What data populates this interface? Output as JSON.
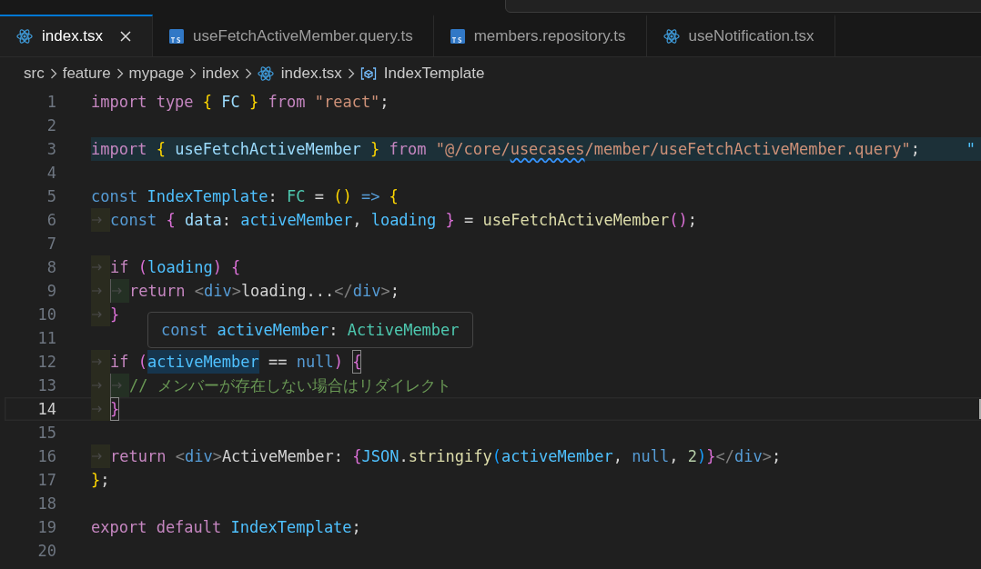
{
  "tabs": [
    {
      "label": "index.tsx",
      "kind": "react",
      "selected": true
    },
    {
      "label": "useFetchActiveMember.query.ts",
      "kind": "ts",
      "selected": false
    },
    {
      "label": "members.repository.ts",
      "kind": "ts",
      "selected": false
    },
    {
      "label": "useNotification.tsx",
      "kind": "react",
      "selected": false
    }
  ],
  "breadcrumb": [
    {
      "label": "src",
      "kind": "folder"
    },
    {
      "label": "feature",
      "kind": "folder"
    },
    {
      "label": "mypage",
      "kind": "folder"
    },
    {
      "label": "index",
      "kind": "folder"
    },
    {
      "label": "index.tsx",
      "kind": "react"
    },
    {
      "label": "IndexTemplate",
      "kind": "symbol"
    }
  ],
  "editor": {
    "lines": [
      {
        "number": "1",
        "current": false,
        "highlighted": false,
        "tokens": [
          {
            "t": "import type ",
            "kind": "kw"
          },
          {
            "t": "{",
            "kind": "b1"
          },
          {
            "t": " FC ",
            "kind": "var"
          },
          {
            "t": "}",
            "kind": "b1"
          },
          {
            "t": " from ",
            "kind": "kw"
          },
          {
            "t": "\"react\"",
            "kind": "str"
          },
          {
            "t": ";",
            "kind": "p"
          }
        ]
      },
      {
        "number": "2",
        "current": false,
        "highlighted": false
      },
      {
        "number": "3",
        "current": false,
        "highlighted": true,
        "tokens": [
          {
            "t": "import ",
            "kind": "kw"
          },
          {
            "t": "{",
            "kind": "b1"
          },
          {
            "t": " useFetchActiveMember ",
            "kind": "var"
          },
          {
            "t": "}",
            "kind": "b1"
          },
          {
            "t": " from ",
            "kind": "kw"
          },
          {
            "t": "\"@/core/",
            "kind": "str"
          },
          {
            "t": "usecases",
            "kind": "str",
            "squiggle": true
          },
          {
            "t": "/member/useFetchActiveMember.query\"",
            "kind": "str"
          },
          {
            "t": ";",
            "kind": "p"
          },
          {
            "t": "\"",
            "kind": "ghost"
          }
        ]
      },
      {
        "number": "4",
        "current": false,
        "highlighted": false
      },
      {
        "number": "5",
        "current": false,
        "highlighted": false,
        "tokens": [
          {
            "t": "const ",
            "kind": "storage"
          },
          {
            "t": "IndexTemplate",
            "kind": "const"
          },
          {
            "t": ": ",
            "kind": "p"
          },
          {
            "t": "FC",
            "kind": "type"
          },
          {
            "t": " = ",
            "kind": "p"
          },
          {
            "t": "()",
            "kind": "b1"
          },
          {
            "t": " => ",
            "kind": "storage"
          },
          {
            "t": "{",
            "kind": "b1"
          }
        ]
      },
      {
        "number": "6",
        "current": false,
        "highlighted": false,
        "indent": [
          {
            "kind": "guide"
          }
        ],
        "tokens": [
          {
            "t": "const ",
            "kind": "storage"
          },
          {
            "t": "{",
            "kind": "b2"
          },
          {
            "t": " data",
            "kind": "var"
          },
          {
            "t": ": ",
            "kind": "p"
          },
          {
            "t": "activeMember",
            "kind": "const"
          },
          {
            "t": ", ",
            "kind": "p"
          },
          {
            "t": "loading ",
            "kind": "const"
          },
          {
            "t": "}",
            "kind": "b2"
          },
          {
            "t": " = ",
            "kind": "p"
          },
          {
            "t": "useFetchActiveMember",
            "kind": "fn"
          },
          {
            "t": "()",
            "kind": "b2"
          },
          {
            "t": ";",
            "kind": "p"
          }
        ]
      },
      {
        "number": "7",
        "current": false,
        "highlighted": false
      },
      {
        "number": "8",
        "current": false,
        "highlighted": false,
        "indent": [
          {
            "kind": "guide"
          }
        ],
        "tokens": [
          {
            "t": "if ",
            "kind": "kw"
          },
          {
            "t": "(",
            "kind": "b2"
          },
          {
            "t": "loading",
            "kind": "const"
          },
          {
            "t": ") {",
            "kind": "b2"
          }
        ]
      },
      {
        "number": "9",
        "current": false,
        "highlighted": false,
        "indent": [
          {
            "kind": "guide"
          },
          {
            "kind": "active"
          }
        ],
        "tokens": [
          {
            "t": "return ",
            "kind": "kw"
          },
          {
            "t": "<",
            "kind": "tagp"
          },
          {
            "t": "div",
            "kind": "tag"
          },
          {
            "t": ">",
            "kind": "tagp"
          },
          {
            "t": "loading...",
            "kind": "p"
          },
          {
            "t": "</",
            "kind": "tagp"
          },
          {
            "t": "div",
            "kind": "tag"
          },
          {
            "t": ">",
            "kind": "tagp"
          },
          {
            "t": ";",
            "kind": "p"
          }
        ]
      },
      {
        "number": "10",
        "current": false,
        "highlighted": false,
        "indent": [
          {
            "kind": "guide"
          }
        ],
        "tokens": [
          {
            "t": "}",
            "kind": "b2"
          }
        ]
      },
      {
        "number": "11",
        "current": false,
        "highlighted": false
      },
      {
        "number": "12",
        "current": false,
        "highlighted": false,
        "indent": [
          {
            "kind": "guide"
          }
        ],
        "tokens": [
          {
            "t": "if ",
            "kind": "kw"
          },
          {
            "t": "(",
            "kind": "b2"
          },
          {
            "t": "activeMember",
            "kind": "const",
            "mark": true
          },
          {
            "t": " == ",
            "kind": "p"
          },
          {
            "t": "null",
            "kind": "storage"
          },
          {
            "t": ") ",
            "kind": "b2"
          },
          {
            "t": "{",
            "kind": "b2",
            "match": true
          }
        ]
      },
      {
        "number": "13",
        "current": false,
        "highlighted": false,
        "indent": [
          {
            "kind": "guide"
          },
          {
            "kind": "active"
          }
        ],
        "tokens": [
          {
            "t": "// メンバーが存在しない場合はリダイレクト",
            "kind": "comment"
          }
        ]
      },
      {
        "number": "14",
        "current": true,
        "highlighted": false,
        "indent": [
          {
            "kind": "guide"
          }
        ],
        "tokens": [
          {
            "t": "}",
            "kind": "b2",
            "match": true
          }
        ]
      },
      {
        "number": "15",
        "current": false,
        "highlighted": false
      },
      {
        "number": "16",
        "current": false,
        "highlighted": false,
        "indent": [
          {
            "kind": "guide"
          }
        ],
        "tokens": [
          {
            "t": "return ",
            "kind": "kw"
          },
          {
            "t": "<",
            "kind": "tagp"
          },
          {
            "t": "div",
            "kind": "tag"
          },
          {
            "t": ">",
            "kind": "tagp"
          },
          {
            "t": "ActiveMember: ",
            "kind": "p"
          },
          {
            "t": "{",
            "kind": "b2"
          },
          {
            "t": "JSON",
            "kind": "const"
          },
          {
            "t": ".",
            "kind": "p"
          },
          {
            "t": "stringify",
            "kind": "fn"
          },
          {
            "t": "(",
            "kind": "b3"
          },
          {
            "t": "activeMember",
            "kind": "const"
          },
          {
            "t": ", ",
            "kind": "p"
          },
          {
            "t": "null",
            "kind": "storage"
          },
          {
            "t": ", ",
            "kind": "p"
          },
          {
            "t": "2",
            "kind": "num"
          },
          {
            "t": ")",
            "kind": "b3"
          },
          {
            "t": "}",
            "kind": "b2"
          },
          {
            "t": "</",
            "kind": "tagp"
          },
          {
            "t": "div",
            "kind": "tag"
          },
          {
            "t": ">",
            "kind": "tagp"
          },
          {
            "t": ";",
            "kind": "p"
          }
        ]
      },
      {
        "number": "17",
        "current": false,
        "highlighted": false,
        "tokens": [
          {
            "t": "}",
            "kind": "b1"
          },
          {
            "t": ";",
            "kind": "p"
          }
        ]
      },
      {
        "number": "18",
        "current": false,
        "highlighted": false
      },
      {
        "number": "19",
        "current": false,
        "highlighted": false,
        "tokens": [
          {
            "t": "export default ",
            "kind": "kw"
          },
          {
            "t": "IndexTemplate",
            "kind": "const"
          },
          {
            "t": ";",
            "kind": "p"
          }
        ]
      },
      {
        "number": "20",
        "current": false,
        "highlighted": false
      }
    ]
  },
  "hover": [
    {
      "t": "const ",
      "kind": "storage"
    },
    {
      "t": "activeMember",
      "kind": "const"
    },
    {
      "t": ": ",
      "kind": "p"
    },
    {
      "t": "ActiveMember",
      "kind": "type"
    }
  ]
}
